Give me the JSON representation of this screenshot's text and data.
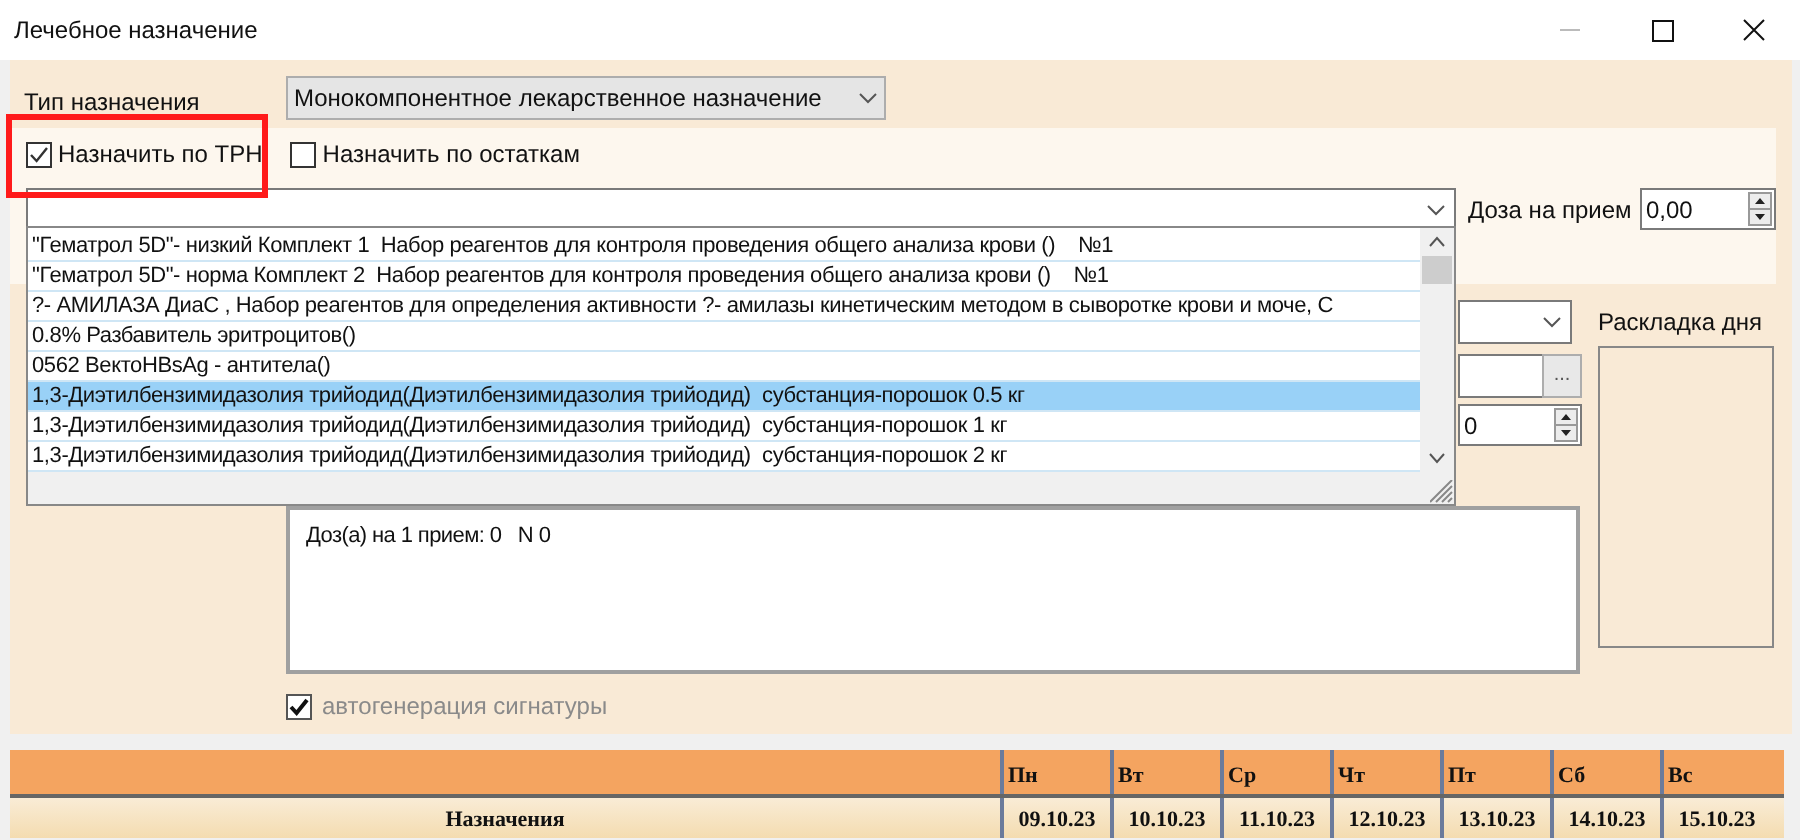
{
  "window": {
    "title": "Лечебное назначение"
  },
  "type": {
    "label": "Тип назначения",
    "value": "Монокомпонентное лекарственное назначение"
  },
  "checkboxes": [
    {
      "label": "Назначить по ТРН",
      "checked": true
    },
    {
      "label": "Назначить по остаткам",
      "checked": false
    }
  ],
  "dose": {
    "label": "Доза на прием",
    "value": "0,00"
  },
  "dropdown_list": {
    "items": [
      {
        "text": "\"Гематрол 5D\"- низкий Комплект 1  Набор реагентов для контроля проведения общего анализа крови ()    №1",
        "selected": false
      },
      {
        "text": "\"Гематрол 5D\"- норма Комплект 2  Набор реагентов для контроля проведения общего анализа крови ()    №1",
        "selected": false
      },
      {
        "text": "?- АМИЛАЗА ДиаС , Набор реагентов для определения активности ?- амилазы кинетическим методом в сыворотке крови и моче, С",
        "selected": false
      },
      {
        "text": "0.8% Разбавитель эритроцитов()",
        "selected": false
      },
      {
        "text": "0562 ВектоHBsAg - антитела()",
        "selected": false
      },
      {
        "text": "1,3-Диэтилбензимидазолия трийодид(Диэтилбензимидазолия трийодид)  субстанция-порошок 0.5 кг",
        "selected": true
      },
      {
        "text": "1,3-Диэтилбензимидазолия трийодид(Диэтилбензимидазолия трийодид)  субстанция-порошок 1 кг",
        "selected": false
      },
      {
        "text": "1,3-Диэтилбензимидазолия трийодид(Диэтилбензимидазолия трийодид)  субстанция-порошок 2 кг",
        "selected": false
      }
    ]
  },
  "browse_button": "...",
  "count_spinner": {
    "value": "0"
  },
  "day_layout": {
    "label": "Раскладка дня"
  },
  "signature": {
    "text": "Доз(а) на 1 прием: 0   N 0"
  },
  "autogen": {
    "label": "автогенерация сигнатуры",
    "checked": true,
    "disabled": true
  },
  "schedule": {
    "row_label": "Назначения",
    "columns": [
      {
        "day": "Пн",
        "date": "09.10.23"
      },
      {
        "day": "Вт",
        "date": "10.10.23"
      },
      {
        "day": "Ср",
        "date": "11.10.23"
      },
      {
        "day": "Чт",
        "date": "12.10.23"
      },
      {
        "day": "Пт",
        "date": "13.10.23"
      },
      {
        "day": "Сб",
        "date": "14.10.23"
      },
      {
        "day": "Вс",
        "date": "15.10.23"
      }
    ]
  }
}
